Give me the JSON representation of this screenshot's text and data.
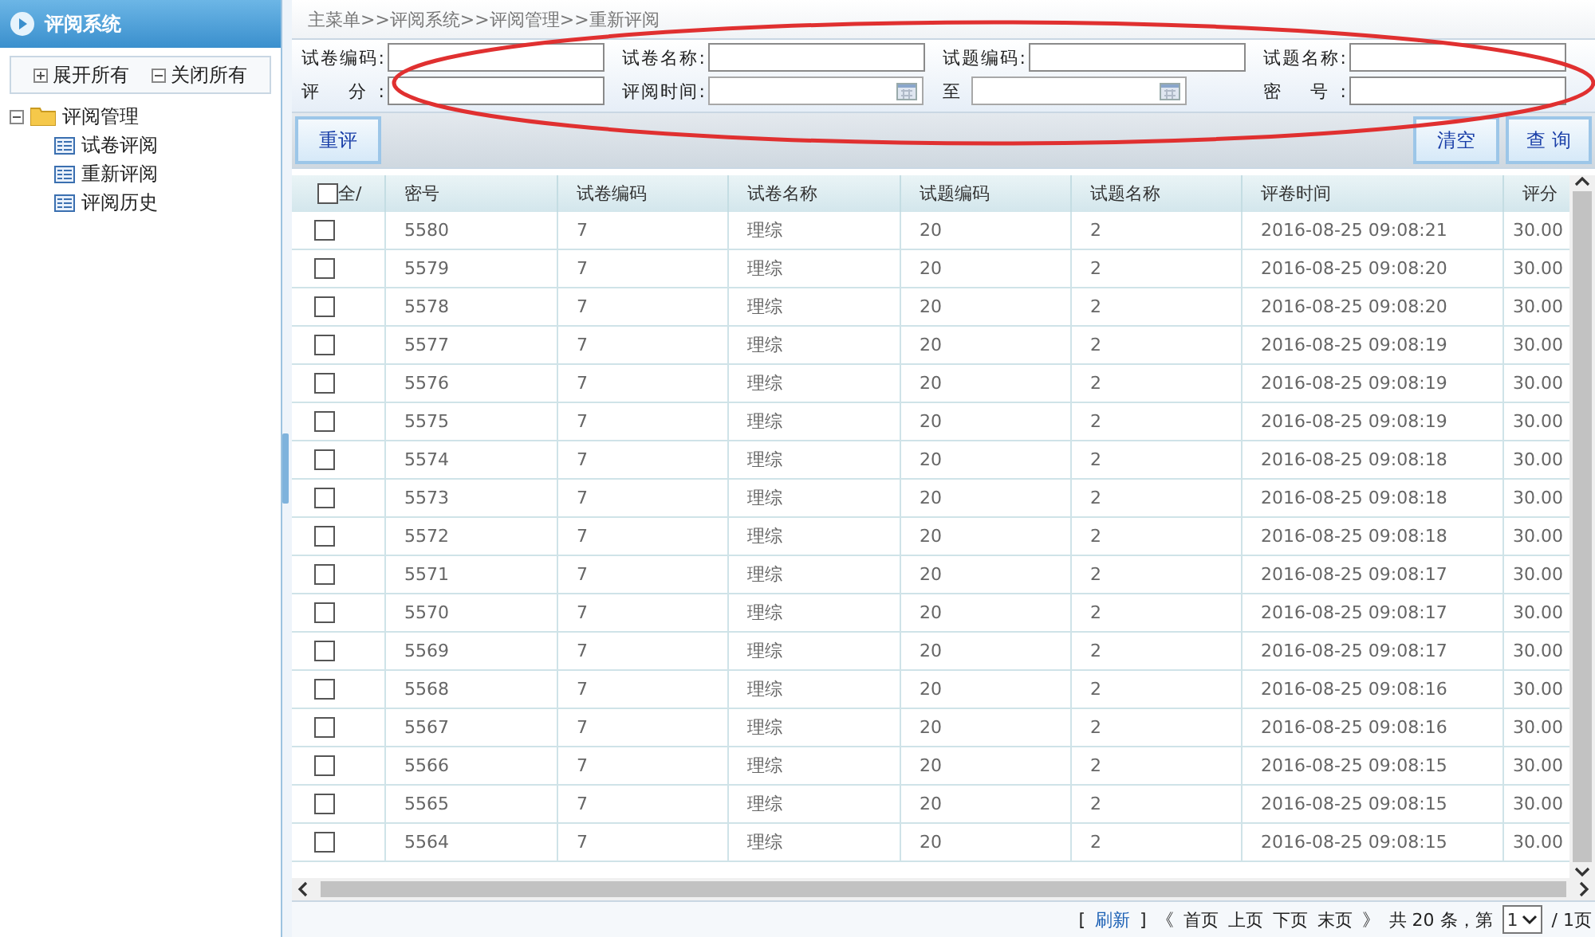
{
  "sidebar": {
    "title": "评阅系统",
    "actions": [
      "展开所有",
      "关闭所有"
    ],
    "tree": [
      {
        "label": "评阅管理",
        "expanded": true,
        "children": [
          {
            "label": "试卷评阅"
          },
          {
            "label": "重新评阅"
          },
          {
            "label": "评阅历史"
          }
        ]
      }
    ]
  },
  "breadcrumb": "主菜单>>评阅系统>>评阅管理>>重新评阅",
  "search_rows": [
    [
      {
        "label": "试卷编码:",
        "kind": "text"
      },
      {
        "label": "试卷名称:",
        "kind": "text"
      },
      {
        "label": "试题编码:",
        "kind": "text"
      },
      {
        "label": "试题名称:",
        "kind": "text"
      }
    ],
    [
      {
        "label": "评 分:",
        "kind": "text"
      },
      {
        "label": "评阅时间:",
        "kind": "date"
      },
      {
        "label": "至",
        "kind": "date"
      },
      {
        "label": "密 号:",
        "kind": "text"
      }
    ]
  ],
  "toolbar": {
    "left": [
      "重评"
    ],
    "right": [
      "清空",
      "查 询"
    ]
  },
  "table": {
    "select_all": {
      "label": "全/",
      "checked": false
    },
    "columns": [
      "密号",
      "试卷编码",
      "试卷名称",
      "试题编码",
      "试题名称",
      "评卷时间",
      "评分"
    ],
    "rows": [
      {
        "checked": false,
        "cells": [
          "5580",
          "7",
          "理综",
          "20",
          "2",
          "2016-08-25 09:08:21",
          "30.00"
        ]
      },
      {
        "checked": false,
        "cells": [
          "5579",
          "7",
          "理综",
          "20",
          "2",
          "2016-08-25 09:08:20",
          "30.00"
        ]
      },
      {
        "checked": false,
        "cells": [
          "5578",
          "7",
          "理综",
          "20",
          "2",
          "2016-08-25 09:08:20",
          "30.00"
        ]
      },
      {
        "checked": false,
        "cells": [
          "5577",
          "7",
          "理综",
          "20",
          "2",
          "2016-08-25 09:08:19",
          "30.00"
        ]
      },
      {
        "checked": false,
        "cells": [
          "5576",
          "7",
          "理综",
          "20",
          "2",
          "2016-08-25 09:08:19",
          "30.00"
        ]
      },
      {
        "checked": false,
        "cells": [
          "5575",
          "7",
          "理综",
          "20",
          "2",
          "2016-08-25 09:08:19",
          "30.00"
        ]
      },
      {
        "checked": false,
        "cells": [
          "5574",
          "7",
          "理综",
          "20",
          "2",
          "2016-08-25 09:08:18",
          "30.00"
        ]
      },
      {
        "checked": false,
        "cells": [
          "5573",
          "7",
          "理综",
          "20",
          "2",
          "2016-08-25 09:08:18",
          "30.00"
        ]
      },
      {
        "checked": false,
        "cells": [
          "5572",
          "7",
          "理综",
          "20",
          "2",
          "2016-08-25 09:08:18",
          "30.00"
        ]
      },
      {
        "checked": false,
        "cells": [
          "5571",
          "7",
          "理综",
          "20",
          "2",
          "2016-08-25 09:08:17",
          "30.00"
        ]
      },
      {
        "checked": false,
        "cells": [
          "5570",
          "7",
          "理综",
          "20",
          "2",
          "2016-08-25 09:08:17",
          "30.00"
        ]
      },
      {
        "checked": false,
        "cells": [
          "5569",
          "7",
          "理综",
          "20",
          "2",
          "2016-08-25 09:08:17",
          "30.00"
        ]
      },
      {
        "checked": false,
        "cells": [
          "5568",
          "7",
          "理综",
          "20",
          "2",
          "2016-08-25 09:08:16",
          "30.00"
        ]
      },
      {
        "checked": false,
        "cells": [
          "5567",
          "7",
          "理综",
          "20",
          "2",
          "2016-08-25 09:08:16",
          "30.00"
        ]
      },
      {
        "checked": false,
        "cells": [
          "5566",
          "7",
          "理综",
          "20",
          "2",
          "2016-08-25 09:08:15",
          "30.00"
        ]
      },
      {
        "checked": false,
        "cells": [
          "5565",
          "7",
          "理综",
          "20",
          "2",
          "2016-08-25 09:08:15",
          "30.00"
        ]
      },
      {
        "checked": false,
        "cells": [
          "5564",
          "7",
          "理综",
          "20",
          "2",
          "2016-08-25 09:08:15",
          "30.00"
        ]
      }
    ]
  },
  "pager": {
    "open": "[",
    "refresh": "刷新",
    "close": "]",
    "links": [
      "《",
      "首页",
      "上页",
      "下页",
      "末页",
      "》"
    ],
    "total": "共 20 条，第",
    "page": "1",
    "pages": "/ 1页"
  }
}
